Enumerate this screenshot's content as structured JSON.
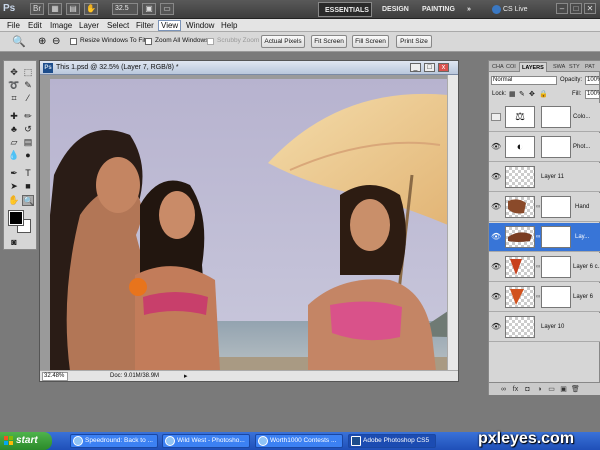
{
  "app": {
    "logo": "Ps",
    "zoom": "32.5",
    "cs_live": "CS Live"
  },
  "workspaces": {
    "essentials": "ESSENTIALS",
    "design": "DESIGN",
    "painting": "PAINTING",
    "more": "»"
  },
  "menu": [
    "File",
    "Edit",
    "Image",
    "Layer",
    "Select",
    "Filter",
    "View",
    "Window",
    "Help"
  ],
  "options": {
    "resize_windows": "Resize Windows To Fit",
    "zoom_all": "Zoom All Windows",
    "scrubby_zoom": "Scrubby Zoom",
    "actual_pixels": "Actual Pixels",
    "fit_screen": "Fit Screen",
    "fill_screen": "Fill Screen",
    "print_size": "Print Size"
  },
  "document": {
    "title": "This 1.psd @ 32.5% (Layer 7, RGB/8) *",
    "icon": "Ps",
    "zoom": "32.48%",
    "size": "Doc: 9.01M/38.9M"
  },
  "layers_panel": {
    "tabs": [
      "CHA",
      "COI",
      "LAYERS",
      "SWA",
      "STY",
      "PAT"
    ],
    "blend_mode": "Normal",
    "opacity_label": "Opacity:",
    "opacity": "100%",
    "lock_label": "Lock:",
    "fill_label": "Fill:",
    "fill": "100%",
    "layers": [
      {
        "name": "Colo...",
        "kind": "adjustment",
        "visible": false,
        "selected": false
      },
      {
        "name": "Phot...",
        "kind": "adjustment",
        "visible": true,
        "selected": false
      },
      {
        "name": "Layer 11",
        "kind": "empty",
        "visible": true,
        "selected": false
      },
      {
        "name": "Hand",
        "kind": "image-mask",
        "visible": true,
        "selected": false
      },
      {
        "name": "Lay...",
        "kind": "image-mask",
        "visible": true,
        "selected": true
      },
      {
        "name": "Layer 6 c...",
        "kind": "image-mask",
        "visible": true,
        "selected": false
      },
      {
        "name": "Layer 6",
        "kind": "image-mask",
        "visible": true,
        "selected": false
      },
      {
        "name": "Layer 10",
        "kind": "empty",
        "visible": true,
        "selected": false
      }
    ]
  },
  "taskbar": {
    "start": "start",
    "tasks": [
      {
        "label": "Speedround: Back to ...",
        "active": false
      },
      {
        "label": "Wild West - Photosho...",
        "active": false
      },
      {
        "label": "Worth1000 Contests ...",
        "active": false
      },
      {
        "label": "Adobe Photoshop CS5",
        "active": true
      }
    ]
  },
  "watermark": "pxleyes.com",
  "colors": {
    "accent": "#3875d7",
    "taskbar": "#245edb",
    "start": "#3b9a39"
  }
}
